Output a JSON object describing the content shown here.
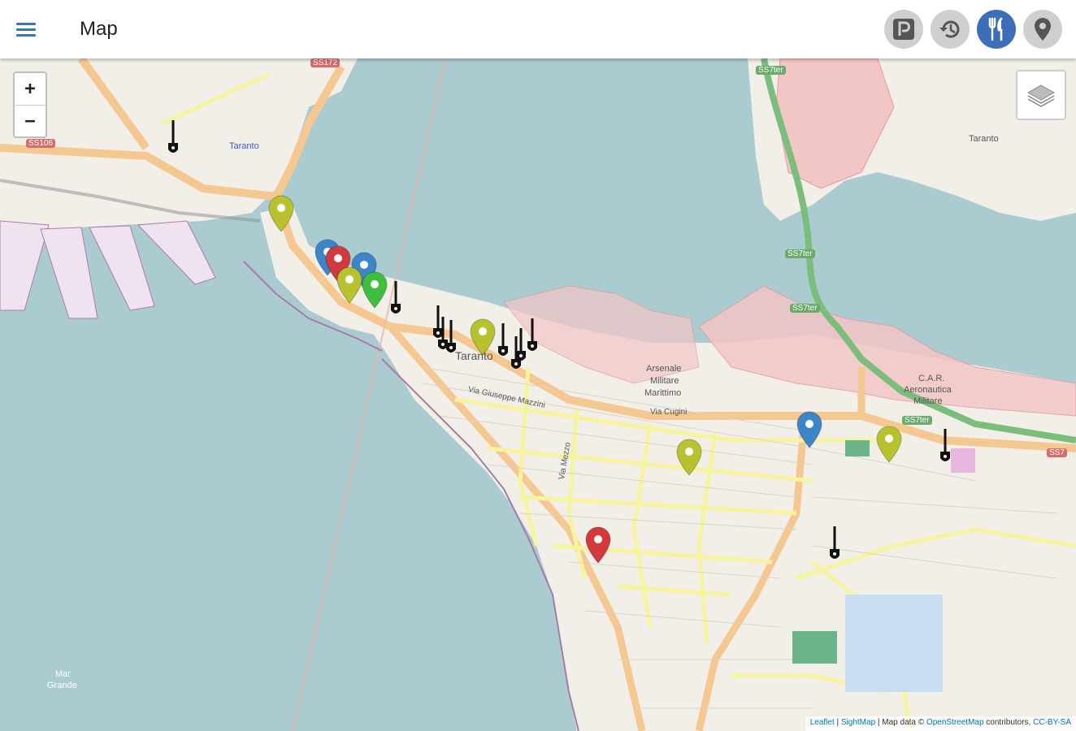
{
  "appbar": {
    "title": "Map",
    "menu_icon": "hamburger-menu-icon",
    "buttons": [
      {
        "id": "parking",
        "icon": "parking-icon",
        "active": false
      },
      {
        "id": "history",
        "icon": "history-icon",
        "active": false
      },
      {
        "id": "restaurant",
        "icon": "fork-knife-icon",
        "active": true
      },
      {
        "id": "location",
        "icon": "map-pin-icon",
        "active": false
      }
    ]
  },
  "map": {
    "zoom_in_label": "+",
    "zoom_out_label": "−",
    "layers_icon": "layers-icon",
    "attribution": {
      "leaflet": "Leaflet",
      "sep1": " | ",
      "sightmap": "SightMap",
      "sep2": " | Map data © ",
      "osm": "OpenStreetMap",
      "contrib": " contributors, ",
      "license": "CC-BY-SA"
    },
    "labels": {
      "taranto_station": "Taranto",
      "taranto_center": "Taranto",
      "taranto_ne": "Taranto",
      "arsenale": "Arsenale",
      "militare": "Militare",
      "marittimo": "Marittimo",
      "car": "C.A.R.",
      "aeronautica": "Aeronautica",
      "militare2": "Militare",
      "mar_grande_1": "Mar",
      "mar_grande_2": "Grande",
      "via_cugini": "Via Cugini",
      "via_mazzini": "Via Giuseppe Mazzini",
      "via_mezzo": "Via Mezzo",
      "ss106": "SS106",
      "ss172": "SS172",
      "ss7ter_1": "SS7ter",
      "ss7ter_2": "SS7ter",
      "ss7ter_3": "SS7ter",
      "ss7ter_4": "SS7ter",
      "ss7_right": "SS7"
    },
    "colors": {
      "water": "#aacbd0",
      "land": "#f2efe9",
      "pin_blue": "#3b86c8",
      "pin_red": "#d23a3e",
      "pin_olive": "#b8c12e",
      "pin_green": "#3fbf3f",
      "appbar_active": "#3d6fb8"
    }
  }
}
